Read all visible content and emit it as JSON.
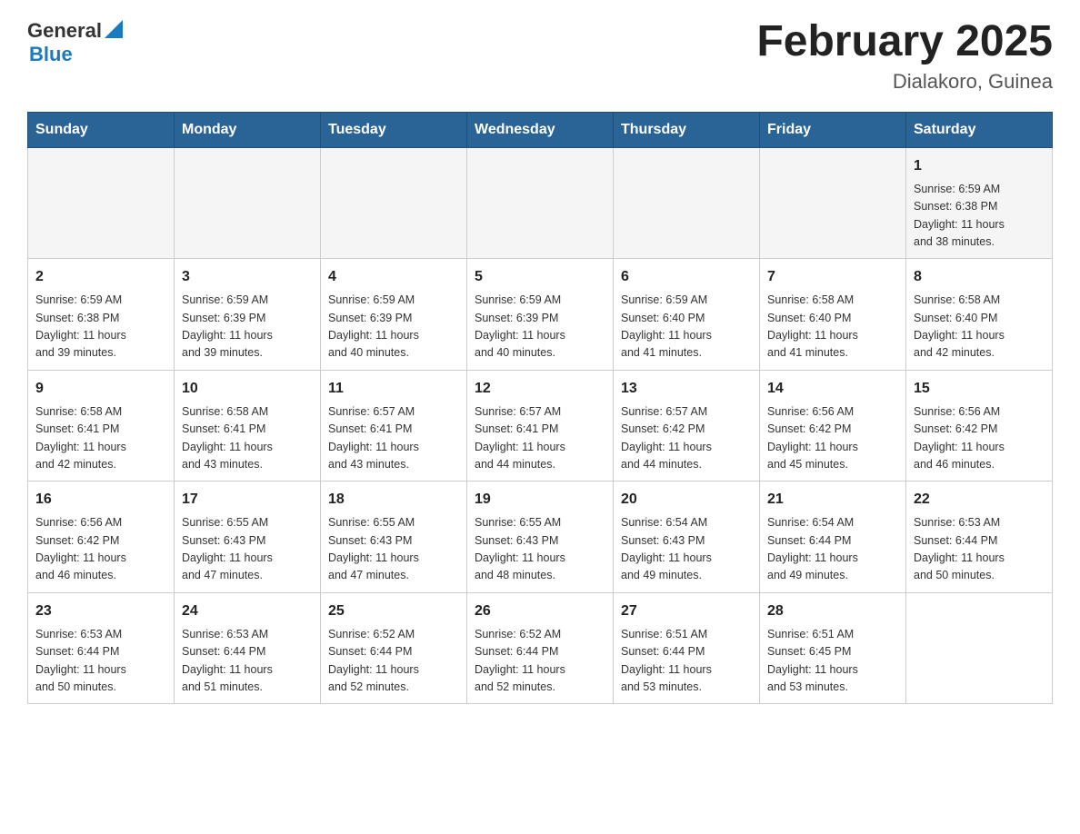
{
  "header": {
    "logo": {
      "general": "General",
      "triangle": "▲",
      "blue": "Blue"
    },
    "title": "February 2025",
    "subtitle": "Dialakoro, Guinea"
  },
  "weekdays": [
    "Sunday",
    "Monday",
    "Tuesday",
    "Wednesday",
    "Thursday",
    "Friday",
    "Saturday"
  ],
  "weeks": [
    [
      {
        "day": "",
        "info": ""
      },
      {
        "day": "",
        "info": ""
      },
      {
        "day": "",
        "info": ""
      },
      {
        "day": "",
        "info": ""
      },
      {
        "day": "",
        "info": ""
      },
      {
        "day": "",
        "info": ""
      },
      {
        "day": "1",
        "info": "Sunrise: 6:59 AM\nSunset: 6:38 PM\nDaylight: 11 hours\nand 38 minutes."
      }
    ],
    [
      {
        "day": "2",
        "info": "Sunrise: 6:59 AM\nSunset: 6:38 PM\nDaylight: 11 hours\nand 39 minutes."
      },
      {
        "day": "3",
        "info": "Sunrise: 6:59 AM\nSunset: 6:39 PM\nDaylight: 11 hours\nand 39 minutes."
      },
      {
        "day": "4",
        "info": "Sunrise: 6:59 AM\nSunset: 6:39 PM\nDaylight: 11 hours\nand 40 minutes."
      },
      {
        "day": "5",
        "info": "Sunrise: 6:59 AM\nSunset: 6:39 PM\nDaylight: 11 hours\nand 40 minutes."
      },
      {
        "day": "6",
        "info": "Sunrise: 6:59 AM\nSunset: 6:40 PM\nDaylight: 11 hours\nand 41 minutes."
      },
      {
        "day": "7",
        "info": "Sunrise: 6:58 AM\nSunset: 6:40 PM\nDaylight: 11 hours\nand 41 minutes."
      },
      {
        "day": "8",
        "info": "Sunrise: 6:58 AM\nSunset: 6:40 PM\nDaylight: 11 hours\nand 42 minutes."
      }
    ],
    [
      {
        "day": "9",
        "info": "Sunrise: 6:58 AM\nSunset: 6:41 PM\nDaylight: 11 hours\nand 42 minutes."
      },
      {
        "day": "10",
        "info": "Sunrise: 6:58 AM\nSunset: 6:41 PM\nDaylight: 11 hours\nand 43 minutes."
      },
      {
        "day": "11",
        "info": "Sunrise: 6:57 AM\nSunset: 6:41 PM\nDaylight: 11 hours\nand 43 minutes."
      },
      {
        "day": "12",
        "info": "Sunrise: 6:57 AM\nSunset: 6:41 PM\nDaylight: 11 hours\nand 44 minutes."
      },
      {
        "day": "13",
        "info": "Sunrise: 6:57 AM\nSunset: 6:42 PM\nDaylight: 11 hours\nand 44 minutes."
      },
      {
        "day": "14",
        "info": "Sunrise: 6:56 AM\nSunset: 6:42 PM\nDaylight: 11 hours\nand 45 minutes."
      },
      {
        "day": "15",
        "info": "Sunrise: 6:56 AM\nSunset: 6:42 PM\nDaylight: 11 hours\nand 46 minutes."
      }
    ],
    [
      {
        "day": "16",
        "info": "Sunrise: 6:56 AM\nSunset: 6:42 PM\nDaylight: 11 hours\nand 46 minutes."
      },
      {
        "day": "17",
        "info": "Sunrise: 6:55 AM\nSunset: 6:43 PM\nDaylight: 11 hours\nand 47 minutes."
      },
      {
        "day": "18",
        "info": "Sunrise: 6:55 AM\nSunset: 6:43 PM\nDaylight: 11 hours\nand 47 minutes."
      },
      {
        "day": "19",
        "info": "Sunrise: 6:55 AM\nSunset: 6:43 PM\nDaylight: 11 hours\nand 48 minutes."
      },
      {
        "day": "20",
        "info": "Sunrise: 6:54 AM\nSunset: 6:43 PM\nDaylight: 11 hours\nand 49 minutes."
      },
      {
        "day": "21",
        "info": "Sunrise: 6:54 AM\nSunset: 6:44 PM\nDaylight: 11 hours\nand 49 minutes."
      },
      {
        "day": "22",
        "info": "Sunrise: 6:53 AM\nSunset: 6:44 PM\nDaylight: 11 hours\nand 50 minutes."
      }
    ],
    [
      {
        "day": "23",
        "info": "Sunrise: 6:53 AM\nSunset: 6:44 PM\nDaylight: 11 hours\nand 50 minutes."
      },
      {
        "day": "24",
        "info": "Sunrise: 6:53 AM\nSunset: 6:44 PM\nDaylight: 11 hours\nand 51 minutes."
      },
      {
        "day": "25",
        "info": "Sunrise: 6:52 AM\nSunset: 6:44 PM\nDaylight: 11 hours\nand 52 minutes."
      },
      {
        "day": "26",
        "info": "Sunrise: 6:52 AM\nSunset: 6:44 PM\nDaylight: 11 hours\nand 52 minutes."
      },
      {
        "day": "27",
        "info": "Sunrise: 6:51 AM\nSunset: 6:44 PM\nDaylight: 11 hours\nand 53 minutes."
      },
      {
        "day": "28",
        "info": "Sunrise: 6:51 AM\nSunset: 6:45 PM\nDaylight: 11 hours\nand 53 minutes."
      },
      {
        "day": "",
        "info": ""
      }
    ]
  ]
}
